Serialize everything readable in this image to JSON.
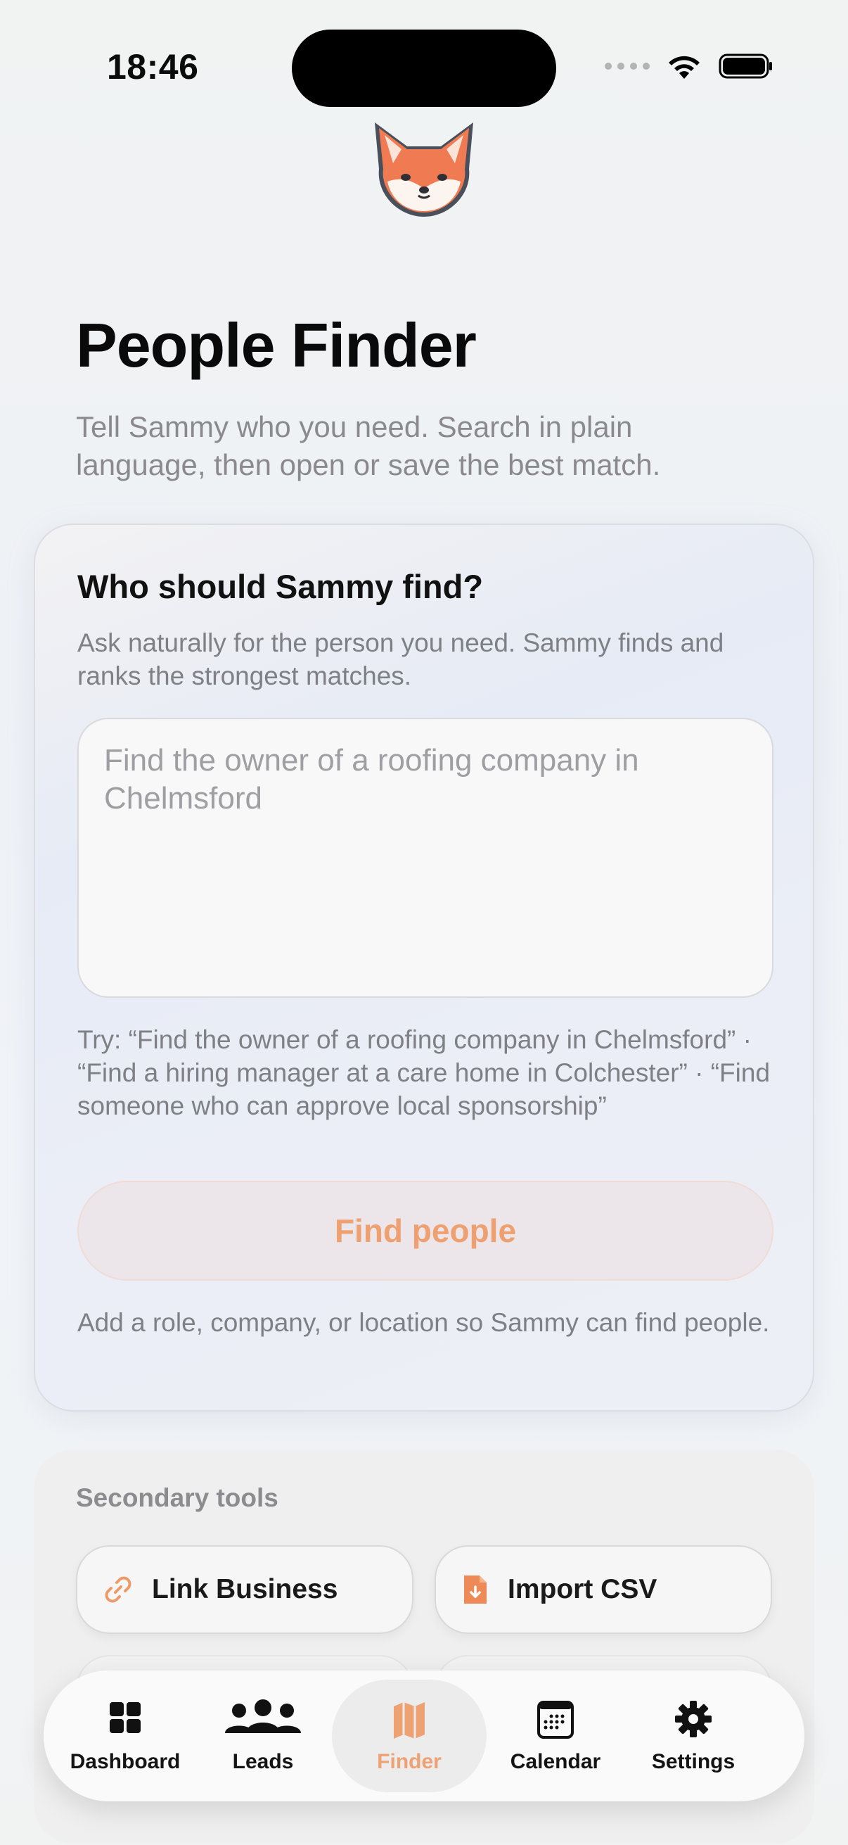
{
  "status_bar": {
    "time": "18:46"
  },
  "header": {
    "title": "People Finder",
    "subtitle": "Tell Sammy who you need. Search in plain language, then open or save the best match."
  },
  "finder": {
    "title": "Who should Sammy find?",
    "description": "Ask naturally for the person you need. Sammy finds and ranks the strongest matches.",
    "query_value": "",
    "query_placeholder": "Find the owner of a roofing company in Chelmsford",
    "examples": "Try: “Find the owner of a roofing company in Chelmsford” · “Find a hiring manager at a care home in Colchester” · “Find someone who can approve local sponsorship”",
    "button_label": "Find people",
    "helper": "Add a role, company, or location so Sammy can find people."
  },
  "secondary_tools": {
    "title": "Secondary tools",
    "items": [
      {
        "label": "Link Business",
        "icon": "link-icon"
      },
      {
        "label": "Import CSV",
        "icon": "file-import-icon"
      }
    ]
  },
  "tab_bar": {
    "active": "Finder",
    "accent_color": "#EEA274",
    "tabs": [
      {
        "label": "Dashboard",
        "icon": "grid-icon"
      },
      {
        "label": "Leads",
        "icon": "people-icon"
      },
      {
        "label": "Finder",
        "icon": "map-icon"
      },
      {
        "label": "Calendar",
        "icon": "calendar-icon"
      },
      {
        "label": "Settings",
        "icon": "gear-icon"
      }
    ]
  }
}
